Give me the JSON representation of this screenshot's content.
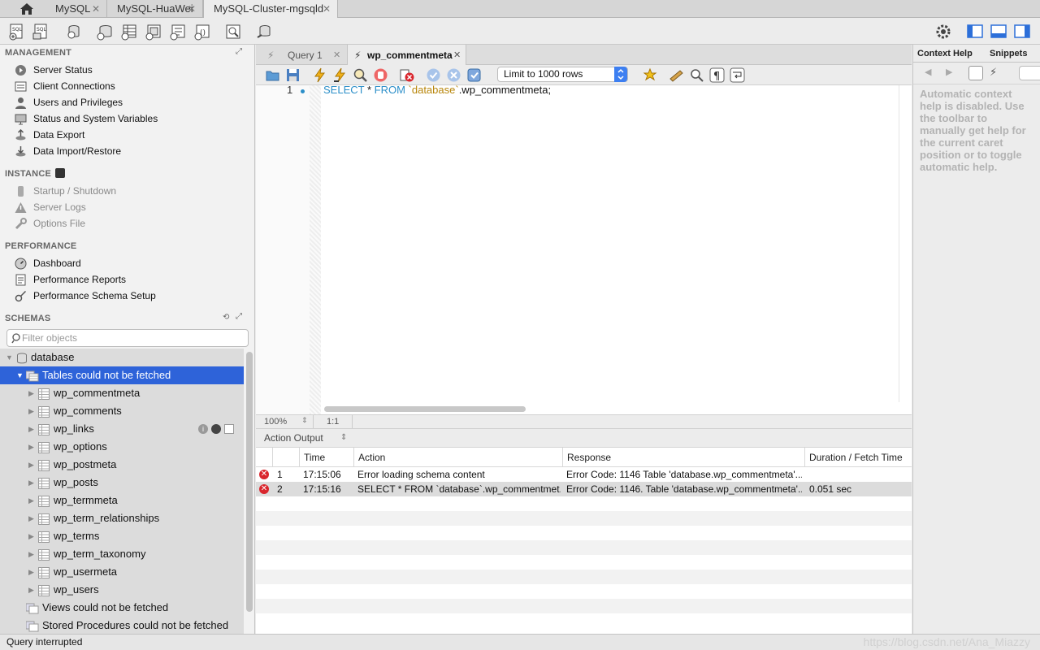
{
  "connection_tabs": [
    {
      "label": "MySQL",
      "close": "✕"
    },
    {
      "label": "MySQL-HuaWei",
      "close": "✕"
    },
    {
      "label": "MySQL-Cluster-mgsqld",
      "close": "✕"
    }
  ],
  "sidebar": {
    "management": {
      "title": "MANAGEMENT",
      "items": [
        {
          "label": "Server Status",
          "icon": "play-circle-icon"
        },
        {
          "label": "Client Connections",
          "icon": "connections-icon"
        },
        {
          "label": "Users and Privileges",
          "icon": "user-icon"
        },
        {
          "label": "Status and System Variables",
          "icon": "monitor-icon"
        },
        {
          "label": "Data Export",
          "icon": "export-icon"
        },
        {
          "label": "Data Import/Restore",
          "icon": "import-icon"
        }
      ]
    },
    "instance": {
      "title": "INSTANCE",
      "items": [
        {
          "label": "Startup / Shutdown",
          "icon": "power-icon"
        },
        {
          "label": "Server Logs",
          "icon": "warning-icon"
        },
        {
          "label": "Options File",
          "icon": "wrench-icon"
        }
      ]
    },
    "performance": {
      "title": "PERFORMANCE",
      "items": [
        {
          "label": "Dashboard",
          "icon": "dashboard-icon"
        },
        {
          "label": "Performance Reports",
          "icon": "report-icon"
        },
        {
          "label": "Performance Schema Setup",
          "icon": "settings-icon"
        }
      ]
    },
    "schemas": {
      "title": "SCHEMAS",
      "filter_placeholder": "Filter objects",
      "database": "database",
      "tables_group": "Tables could not be fetched",
      "tables": [
        "wp_commentmeta",
        "wp_comments",
        "wp_links",
        "wp_options",
        "wp_postmeta",
        "wp_posts",
        "wp_termmeta",
        "wp_term_relationships",
        "wp_terms",
        "wp_term_taxonomy",
        "wp_usermeta",
        "wp_users"
      ],
      "views_group": "Views could not be fetched",
      "procedures_group": "Stored Procedures could not be fetched"
    }
  },
  "query_tabs": [
    {
      "label": "Query 1",
      "close": "✕"
    },
    {
      "label": "wp_commentmeta",
      "close": "✕"
    }
  ],
  "query_toolbar": {
    "limit_label": "Limit to 1000 rows"
  },
  "editor": {
    "line_number": "1",
    "sql": {
      "kw1": "SELECT",
      "star": " * ",
      "kw2": "FROM",
      "schema": " `database`",
      "rest": ".wp_commentmeta;"
    },
    "zoom": "100%",
    "cursor": "1:1"
  },
  "output": {
    "selector_label": "Action Output",
    "columns": [
      "Time",
      "Action",
      "Response",
      "Duration / Fetch Time"
    ],
    "rows": [
      {
        "num": "1",
        "time": "17:15:06",
        "action": "Error loading schema content",
        "response": "Error Code: 1146 Table 'database.wp_commentmeta'...",
        "duration": ""
      },
      {
        "num": "2",
        "time": "17:15:16",
        "action": "SELECT * FROM `database`.wp_commentmet...",
        "response": "Error Code: 1146. Table 'database.wp_commentmeta'...",
        "duration": "0.051 sec"
      }
    ]
  },
  "right_panel": {
    "tabs": [
      "Context Help",
      "Snippets"
    ],
    "help_text": "Automatic context help is disabled. Use the toolbar to manually get help for the current caret position or to toggle automatic help."
  },
  "status": {
    "text": "Query interrupted",
    "watermark": "https://blog.csdn.net/Ana_Miazzy"
  },
  "colors": {
    "selection": "#2e63d9",
    "sql_keyword": "#2c8fc9",
    "sql_identifier": "#b8860b",
    "error": "#d9262d"
  }
}
